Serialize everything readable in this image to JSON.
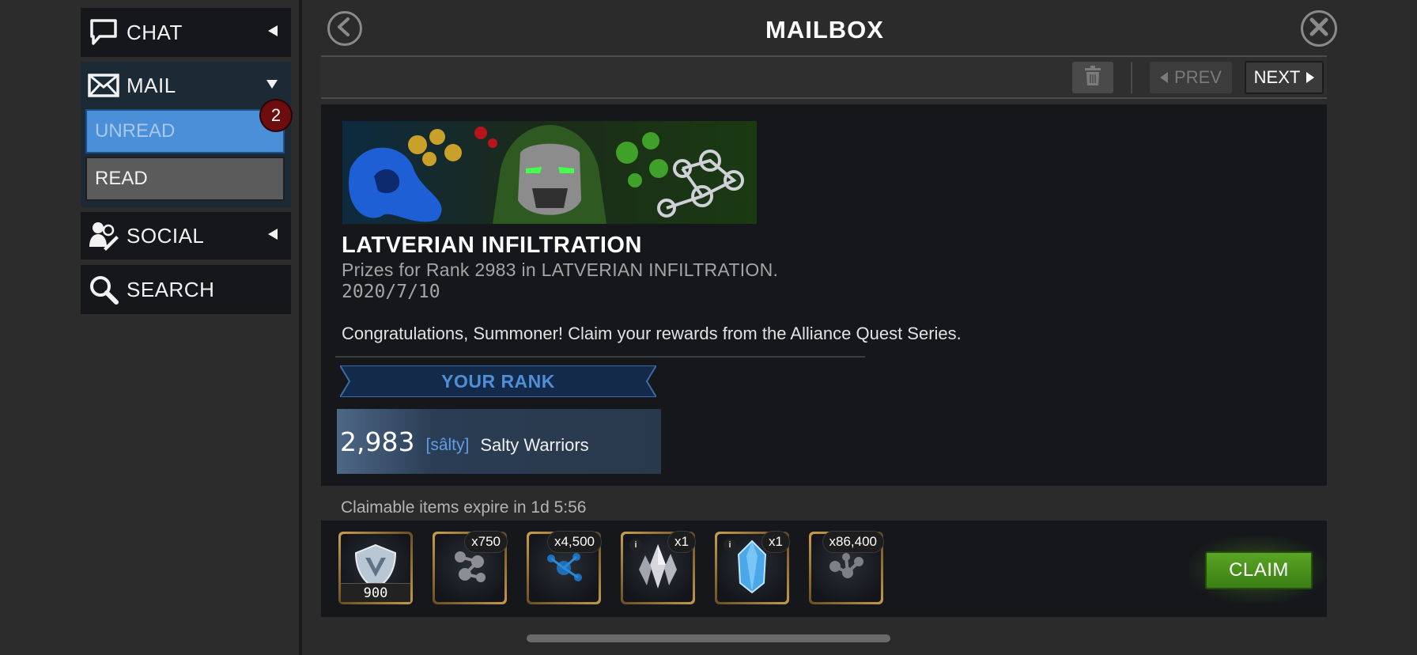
{
  "sidebar": {
    "chat": {
      "label": "CHAT",
      "icon": "chat-bubble-icon"
    },
    "mail": {
      "label": "MAIL",
      "icon": "envelope-icon",
      "unread_count": "2",
      "submenu": [
        {
          "label": "UNREAD",
          "active": true
        },
        {
          "label": "READ",
          "active": false
        }
      ]
    },
    "social": {
      "label": "SOCIAL",
      "icon": "people-icon"
    },
    "search": {
      "label": "SEARCH",
      "icon": "magnifier-icon"
    }
  },
  "header": {
    "title": "MAILBOX",
    "back_icon": "back-arrow-icon",
    "close_icon": "close-icon"
  },
  "toolbar": {
    "delete_icon": "trash-icon",
    "prev_label": "PREV",
    "next_label": "NEXT"
  },
  "mail": {
    "title": "LATVERIAN INFILTRATION",
    "subtitle": "Prizes for Rank 2983 in LATVERIAN INFILTRATION.",
    "date": "2020/7/10",
    "body": "Congratulations, Summoner! Claim your rewards from the Alliance Quest Series.",
    "rank_heading": "YOUR RANK",
    "rank": {
      "number": "2,983",
      "tag": "[sâlty]",
      "alliance": "Salty Warriors"
    }
  },
  "rewards": {
    "expire_text": "Claimable items expire in 1d 5:56",
    "items": [
      {
        "name": "alliance-shield-icon",
        "count": "900"
      },
      {
        "name": "gold-catalyst-icon",
        "quantity": "x750"
      },
      {
        "name": "blue-catalyst-icon",
        "quantity": "x4,500"
      },
      {
        "name": "crystal-cluster-icon",
        "quantity": "x1",
        "info": "i"
      },
      {
        "name": "blue-crystal-icon",
        "quantity": "x1",
        "info": "i"
      },
      {
        "name": "gray-catalyst-icon",
        "quantity": "x86,400"
      }
    ],
    "claim_label": "CLAIM"
  },
  "colors": {
    "accent_blue": "#4a8fd8",
    "badge_red": "#6d0d0d",
    "claim_green": "#4f9a1f",
    "panel": "#15171b"
  }
}
